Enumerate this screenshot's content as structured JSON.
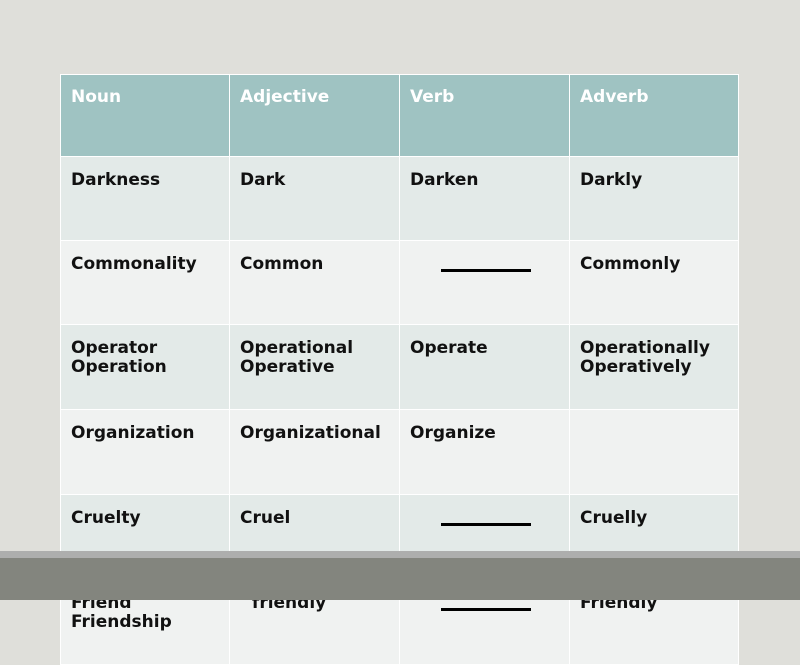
{
  "slide": {
    "background_color": "#dfdfda",
    "footer": {
      "light_bar_color": "#adaead",
      "dark_bar_color": "#83857e"
    }
  },
  "table": {
    "header_background": "#9fc3c2",
    "header_text_color": "#ffffff",
    "row_odd_background": "#e3eae8",
    "row_even_background": "#f0f2f1",
    "headers": [
      "Noun",
      "Adjective",
      "Verb",
      "Adverb"
    ],
    "rows": [
      {
        "noun": [
          "Darkness"
        ],
        "adjective": [
          "Dark"
        ],
        "verb": [
          "Darken"
        ],
        "adverb": [
          "Darkly"
        ]
      },
      {
        "noun": [
          "Commonality"
        ],
        "adjective": [
          "Common"
        ],
        "verb": [
          "__blank__"
        ],
        "adverb": [
          "Commonly"
        ]
      },
      {
        "noun": [
          "Operator",
          "Operation"
        ],
        "adjective": [
          "Operational",
          "Operative"
        ],
        "verb": [
          "Operate"
        ],
        "adverb": [
          "Operationally",
          "Operatively"
        ]
      },
      {
        "noun": [
          "Organization"
        ],
        "adjective": [
          "Organizational"
        ],
        "verb": [
          "Organize"
        ],
        "adverb": [
          ""
        ]
      },
      {
        "noun": [
          "Cruelty"
        ],
        "adjective": [
          "Cruel"
        ],
        "verb": [
          "__blank__"
        ],
        "adverb": [
          "Cruelly"
        ]
      },
      {
        "noun": [
          "Friend",
          "Friendship"
        ],
        "adjective": [
          " friendly"
        ],
        "verb": [
          "__blank__"
        ],
        "adverb": [
          "Friendly"
        ]
      }
    ]
  }
}
